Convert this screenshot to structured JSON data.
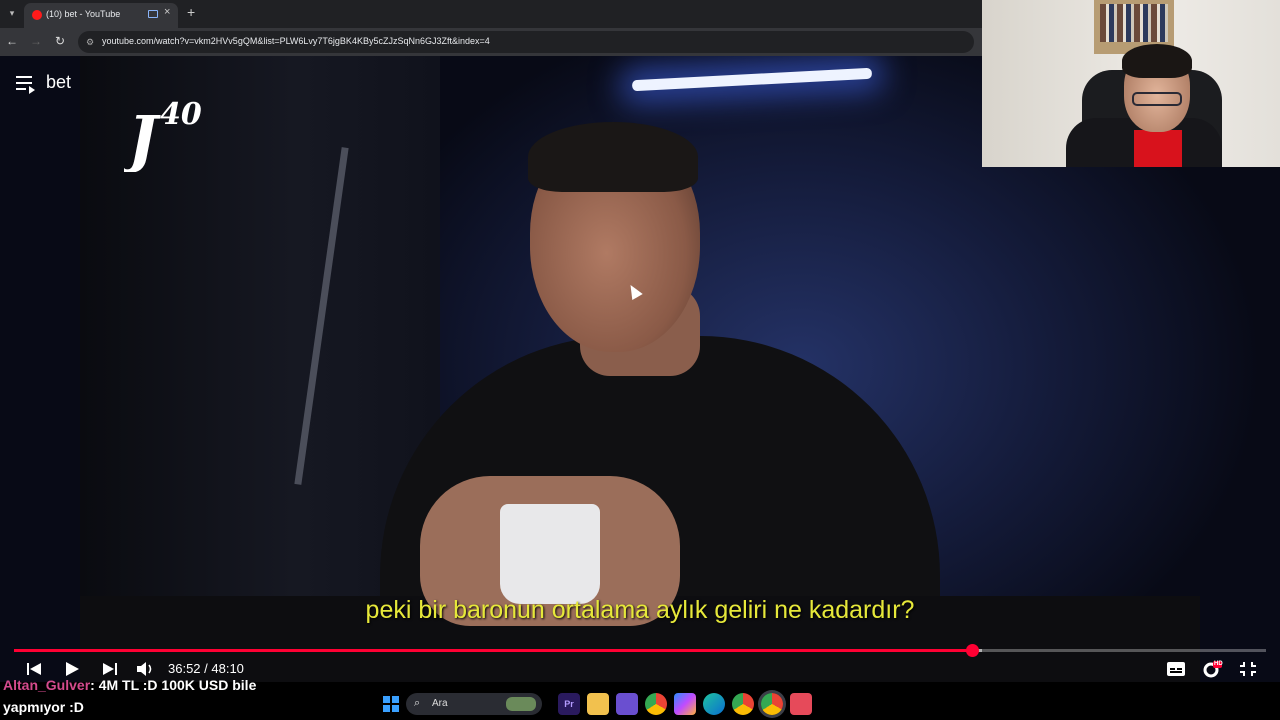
{
  "browser": {
    "tab_title": "(10) bet - YouTube",
    "new_tab_symbol": "+",
    "close_symbol": "×",
    "url": "youtube.com/watch?v=vkm2HVv5gQM&list=PLW6Lvy7T6jgBK4KBy5cZJzSqNn6GJ3Zft&index=4"
  },
  "player": {
    "playlist_title": "bet",
    "channel_logo": "J40",
    "subtitle": "peki bir baronun ortalama aylık geliri ne kadardır?",
    "current_time": "36:52",
    "duration": "48:10",
    "time_display": "36:52 / 48:10",
    "progress_fraction": 0.7654,
    "buffer_fraction": 0.7735,
    "hd_badge": "HD"
  },
  "chat": {
    "user": "Altan_Gulver",
    "message_line1": ": 4M TL :D 100K USD bile",
    "message_line2": "yapmıyor :D"
  },
  "taskbar": {
    "search_label": "Ara",
    "icons": [
      "windows-start-icon",
      "search-icon",
      "car-game-icon",
      "premiere-icon",
      "file-explorer-icon",
      "snipping-tool-icon",
      "chrome-icon",
      "copilot-icon",
      "edge-icon",
      "chrome-alt-icon",
      "chrome-dev-icon",
      "app-icon"
    ]
  },
  "colors": {
    "accent_red": "#ff0033",
    "subtitle_yellow": "#e6e83a",
    "chat_user_pink": "#d44b8e"
  }
}
